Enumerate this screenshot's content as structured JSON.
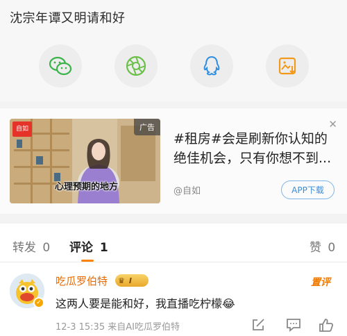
{
  "header": {
    "title": "沈宗年谭又明请和好"
  },
  "share": {
    "items": [
      {
        "name": "wechat",
        "color": "#3bb34a"
      },
      {
        "name": "moments",
        "color": "#6cc04a"
      },
      {
        "name": "qq",
        "color": "#2f8ee0"
      },
      {
        "name": "save-image",
        "color": "#f29a1b"
      }
    ]
  },
  "ad": {
    "badge": "广告",
    "logo_text": "自如",
    "video_caption": "心理预期的地方",
    "text": "#租房#会是刷新你认知的绝佳机会，只有你想不到...",
    "source": "@自如",
    "app_button": "APP下载"
  },
  "tabs": {
    "reposts_label": "转发",
    "reposts_count": "0",
    "comments_label": "评论",
    "comments_count": "1",
    "likes_label": "赞",
    "likes_count": "0",
    "accent_color": "#ff8200"
  },
  "comment": {
    "username": "吃瓜罗伯特",
    "member_level": "I",
    "hot_tag": "置评",
    "body": "这两人要是能和好，我直播吃柠檬😂",
    "meta": "12-3 15:35  来自AI吃瓜罗伯特",
    "username_color": "#e96a00"
  }
}
